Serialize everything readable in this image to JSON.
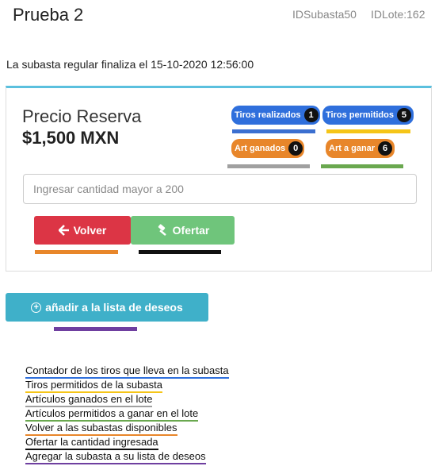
{
  "header": {
    "title": "Prueba 2",
    "id_subasta": "IDSubasta50",
    "id_lote": "IDLote:162"
  },
  "auction_end_text": "La subasta regular finaliza el 15-10-2020 12:56:00",
  "reserve": {
    "label": "Precio Reserva",
    "price": "$1,500 MXN"
  },
  "badges": {
    "tiros_realizados": {
      "label": "Tiros realizados",
      "count": "1"
    },
    "tiros_permitidos": {
      "label": "Tiros permitidos",
      "count": "5"
    },
    "art_ganados": {
      "label": "Art ganados",
      "count": "0"
    },
    "art_a_ganar": {
      "label": "Art a ganar",
      "count": "6"
    }
  },
  "amount_input": {
    "placeholder": "Ingresar cantidad mayor a 200",
    "value": ""
  },
  "buttons": {
    "back_label": "Volver",
    "offer_label": "Ofertar",
    "wishlist_label": "añadir a la lista de deseos"
  },
  "legend": [
    {
      "text": "Contador de los tiros que lleva en la subasta",
      "color": "#2f6fdc"
    },
    {
      "text": "Tiros permitidos de la subasta",
      "color": "#f5c518"
    },
    {
      "text": "Artículos ganados en el lote",
      "color": "#a0a0a0"
    },
    {
      "text": "Artículos permitidos a ganar en el lote",
      "color": "#6aa84f"
    },
    {
      "text": "Volver a las subastas disponibles",
      "color": "#e8862a"
    },
    {
      "text": "Ofertar la cantidad ingresada",
      "color": "#111111"
    },
    {
      "text": "Agregar la subasta a su lista de deseos",
      "color": "#6f3fa0"
    }
  ],
  "colors": {
    "accent_top_border": "#5bc0de",
    "back_button": "#dc3545",
    "offer_button": "#6fc57b",
    "wishlist_button": "#3fb0c9"
  }
}
